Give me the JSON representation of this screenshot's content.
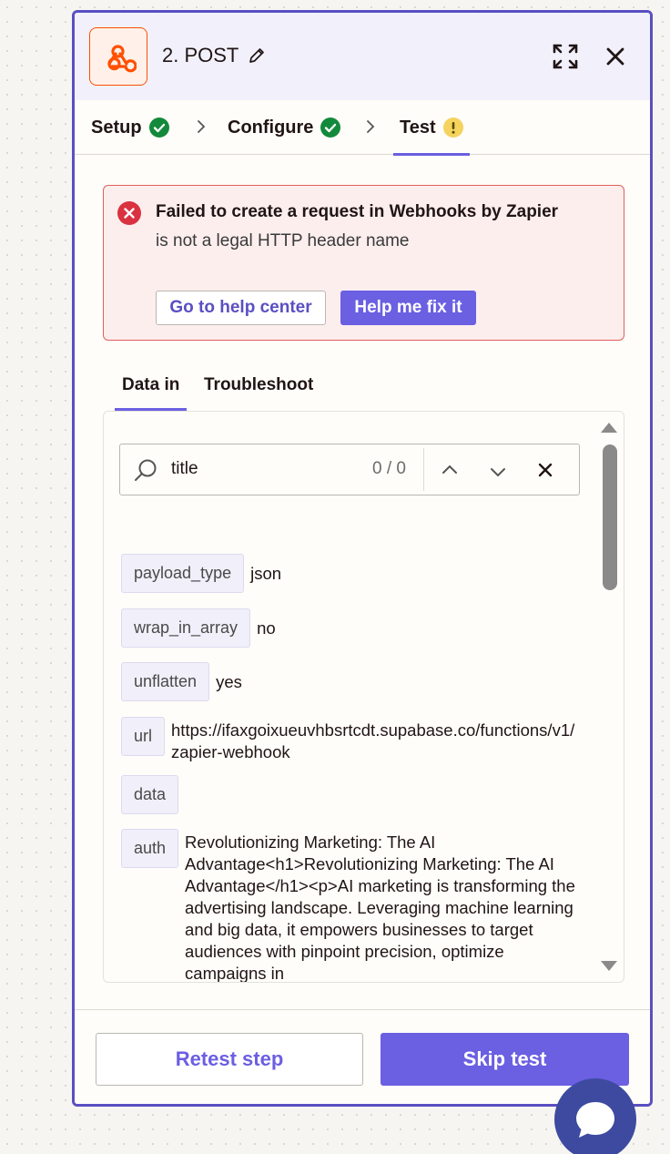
{
  "header": {
    "title": "2. POST",
    "app_icon": "webhook-icon",
    "accent": "#ff4f00"
  },
  "steps": [
    {
      "label": "Setup",
      "status": "complete"
    },
    {
      "label": "Configure",
      "status": "complete"
    },
    {
      "label": "Test",
      "status": "warning"
    }
  ],
  "alert": {
    "title": "Failed to create a request in Webhooks by Zapier",
    "message": "is not a legal HTTP header name",
    "help_button": "Go to help center",
    "fix_button": "Help me fix it"
  },
  "subtabs": [
    "Data in",
    "Troubleshoot"
  ],
  "search": {
    "value": "title",
    "count": "0 / 0"
  },
  "fields": [
    {
      "key": "payload_type",
      "value": "json"
    },
    {
      "key": "wrap_in_array",
      "value": "no"
    },
    {
      "key": "unflatten",
      "value": "yes"
    },
    {
      "key": "url",
      "value": "https://ifaxgoixueuvhbsrtcdt.supabase.co/functions/v1/zapier-webhook"
    },
    {
      "key": "data",
      "value": ""
    },
    {
      "key": "auth",
      "value": "Revolutionizing Marketing: The AI Advantage<h1>Revolutionizing Marketing: The AI Advantage</h1><p>AI marketing is transforming the advertising landscape. Leveraging machine learning and big data, it empowers businesses to target audiences with pinpoint precision, optimize campaigns in"
    }
  ],
  "footer": {
    "retest": "Retest step",
    "skip": "Skip test"
  },
  "colors": {
    "primary": "#6b5fe2",
    "success": "#138a3b",
    "warning": "#f4d35e",
    "error": "#d93240"
  }
}
